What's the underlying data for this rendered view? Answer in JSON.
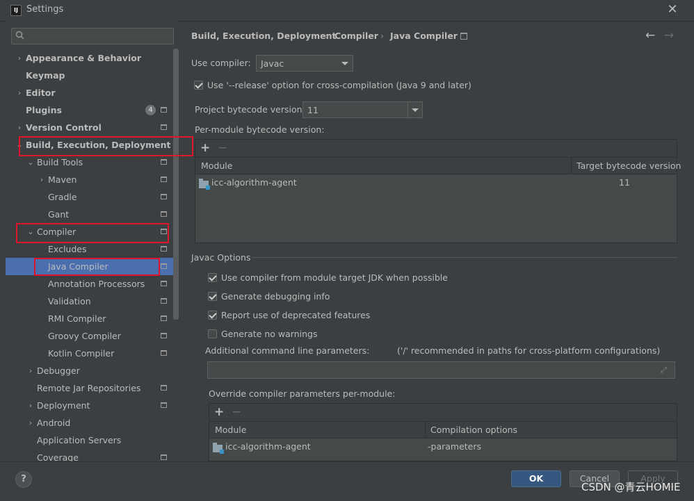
{
  "window": {
    "title": "Settings",
    "app_icon_text": "IJ"
  },
  "sidebar": {
    "search_placeholder": "Q·",
    "items": [
      {
        "label": "Appearance & Behavior",
        "arrow": "›"
      },
      {
        "label": "Keymap"
      },
      {
        "label": "Editor",
        "arrow": "›"
      },
      {
        "label": "Plugins",
        "badge": "4"
      },
      {
        "label": "Version Control",
        "arrow": "›"
      },
      {
        "label": "Build, Execution, Deployment",
        "arrow": "⌄"
      },
      {
        "label": "Build Tools",
        "arrow": "⌄"
      },
      {
        "label": "Maven",
        "arrow": "›"
      },
      {
        "label": "Gradle"
      },
      {
        "label": "Gant"
      },
      {
        "label": "Compiler",
        "arrow": "⌄"
      },
      {
        "label": "Excludes"
      },
      {
        "label": "Java Compiler"
      },
      {
        "label": "Annotation Processors"
      },
      {
        "label": "Validation"
      },
      {
        "label": "RMI Compiler"
      },
      {
        "label": "Groovy Compiler"
      },
      {
        "label": "Kotlin Compiler"
      },
      {
        "label": "Debugger",
        "arrow": "›"
      },
      {
        "label": "Remote Jar Repositories"
      },
      {
        "label": "Deployment",
        "arrow": "›"
      },
      {
        "label": "Android",
        "arrow": "›"
      },
      {
        "label": "Application Servers"
      },
      {
        "label": "Coverage"
      }
    ]
  },
  "breadcrumb": {
    "items": [
      "Build, Execution, Deployment",
      "Compiler",
      "Java Compiler"
    ],
    "separator": "›",
    "back_icon": "←",
    "forward_icon": "→"
  },
  "compiler": {
    "use_compiler_label": "Use compiler:",
    "use_compiler_value": "Javac",
    "release_option_label": "Use '--release' option for cross-compilation (Java 9 and later)",
    "project_bytecode_label": "Project bytecode version:",
    "project_bytecode_value": "11",
    "per_module_label": "Per-module bytecode version:",
    "module_table": {
      "headers": [
        "Module",
        "Target bytecode version"
      ],
      "rows": [
        {
          "module": "icc-algorithm-agent",
          "version": "11"
        }
      ]
    }
  },
  "javac_options": {
    "section_title": "Javac Options",
    "checkboxes": [
      {
        "label": "Use compiler from module target JDK when possible",
        "checked": true
      },
      {
        "label": "Generate debugging info",
        "checked": true
      },
      {
        "label": "Report use of deprecated features",
        "checked": true
      },
      {
        "label": "Generate no warnings",
        "checked": false
      }
    ],
    "additional_params_label": "Additional command line parameters:",
    "additional_params_hint": "('/' recommended in paths for cross-platform configurations)",
    "additional_params_value": "",
    "override_label": "Override compiler parameters per-module:",
    "override_table": {
      "headers": [
        "Module",
        "Compilation options"
      ],
      "rows": [
        {
          "module": "icc-algorithm-agent",
          "options": "-parameters"
        }
      ]
    }
  },
  "footer": {
    "help": "?",
    "ok": "OK",
    "cancel": "Cancel",
    "apply": "Apply"
  },
  "watermark": "CSDN @青云HOMIE",
  "icons": {
    "add": "+",
    "remove": "−",
    "close": "✕",
    "expand": "⤢"
  },
  "colors": {
    "selection": "#4b6eaf",
    "highlight_box": "#e0142a",
    "ok_button": "#365880"
  }
}
